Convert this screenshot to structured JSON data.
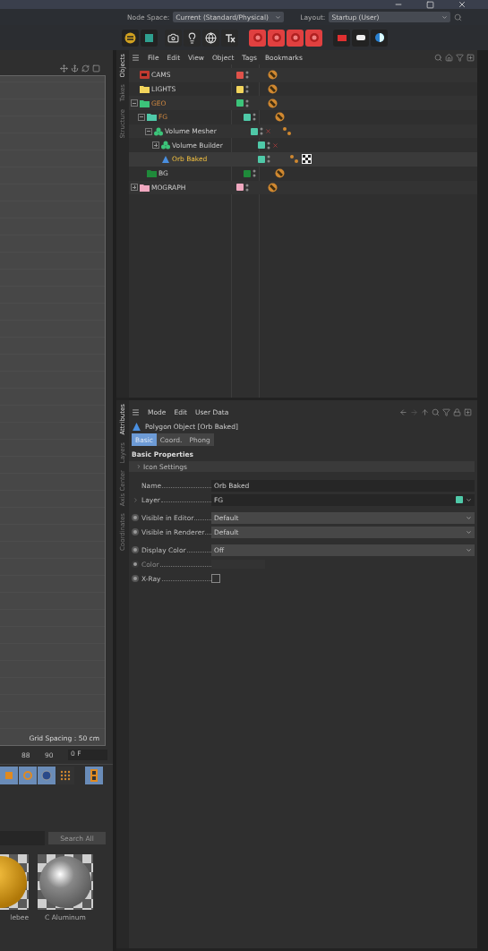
{
  "header": {
    "node_space_label": "Node Space:",
    "node_space_value": "Current (Standard/Physical)",
    "layout_label": "Layout:",
    "layout_value": "Startup (User)"
  },
  "viewport": {
    "grid_spacing": "Grid Spacing : 50 cm"
  },
  "timeline": {
    "ticks": [
      "88",
      "90"
    ],
    "frame": "0 F"
  },
  "material_browser": {
    "search_button": "Search All",
    "materials": [
      {
        "name": "lebee",
        "kind": "gold"
      },
      {
        "name": "C Aluminum",
        "kind": "metal"
      }
    ]
  },
  "object_manager": {
    "side_tabs": [
      {
        "label": "Objects",
        "selected": true
      },
      {
        "label": "Takes",
        "selected": false
      },
      {
        "label": "Structure",
        "selected": false
      }
    ],
    "menu": [
      "File",
      "Edit",
      "View",
      "Object",
      "Tags",
      "Bookmarks"
    ],
    "tree": [
      {
        "name": "CAMS",
        "kind": "camera-folder",
        "color": "#e0524a",
        "tags": [
          {
            "kind": "phong"
          }
        ]
      },
      {
        "name": "LIGHTS",
        "kind": "folder",
        "color": "#f2d45c",
        "tags": [
          {
            "kind": "phong"
          }
        ]
      },
      {
        "name": "GEO",
        "kind": "folder",
        "color": "#3cc47a",
        "in_path": true,
        "expanded": true,
        "tags": [
          {
            "kind": "phong"
          }
        ],
        "children": [
          {
            "name": "FG",
            "kind": "folder",
            "color": "#4fc9a8",
            "in_path": true,
            "expanded": true,
            "tags": [
              {
                "kind": "phong"
              }
            ],
            "children": [
              {
                "name": "Volume Mesher",
                "kind": "volume",
                "color": "#4fc9a8",
                "enabled": false,
                "expanded": true,
                "tags": [
                  {
                    "kind": "dots"
                  }
                ],
                "children": [
                  {
                    "name": "Volume Builder",
                    "kind": "volume",
                    "color": "#4fc9a8",
                    "enabled": false,
                    "expanded": false
                  },
                  {
                    "name": "Orb Baked",
                    "kind": "polygon",
                    "color": "#4fc9a8",
                    "selected": true,
                    "tags": [
                      {
                        "kind": "dots"
                      },
                      {
                        "kind": "checker"
                      }
                    ]
                  }
                ]
              }
            ]
          },
          {
            "name": "BG",
            "kind": "folder",
            "color": "#1f8a3a",
            "tags": [
              {
                "kind": "phong"
              }
            ]
          }
        ]
      },
      {
        "name": "MOGRAPH",
        "kind": "folder",
        "color": "#f0a8c0",
        "expanded": false,
        "tags": [
          {
            "kind": "phong"
          }
        ]
      }
    ]
  },
  "attributes": {
    "side_tabs": [
      {
        "label": "Attributes",
        "selected": true
      },
      {
        "label": "Layers",
        "selected": false
      },
      {
        "label": "Axis Center",
        "selected": false
      },
      {
        "label": "Coordinates",
        "selected": false
      }
    ],
    "menu": [
      "Mode",
      "Edit",
      "User Data"
    ],
    "title": "Polygon Object [Orb Baked]",
    "tabs": [
      {
        "label": "Basic",
        "selected": true
      },
      {
        "label": "Coord.",
        "selected": false
      },
      {
        "label": "Phong",
        "selected": false
      }
    ],
    "section": "Basic Properties",
    "group": {
      "label": "Icon Settings",
      "expanded": false
    },
    "fields": [
      {
        "kind": "text",
        "label": "Name",
        "value": "Orb Baked"
      },
      {
        "kind": "link",
        "label": "Layer",
        "value": "FG",
        "color": "#4fc9a8"
      },
      {
        "kind": "select",
        "label": "Visible in Editor",
        "value": "Default"
      },
      {
        "kind": "select",
        "label": "Visible in Renderer",
        "value": "Default"
      },
      {
        "kind": "select",
        "label": "Display Color",
        "value": "Off"
      },
      {
        "kind": "color",
        "label": "Color",
        "disabled": true
      },
      {
        "kind": "checkbox",
        "label": "X-Ray",
        "checked": false
      }
    ]
  }
}
